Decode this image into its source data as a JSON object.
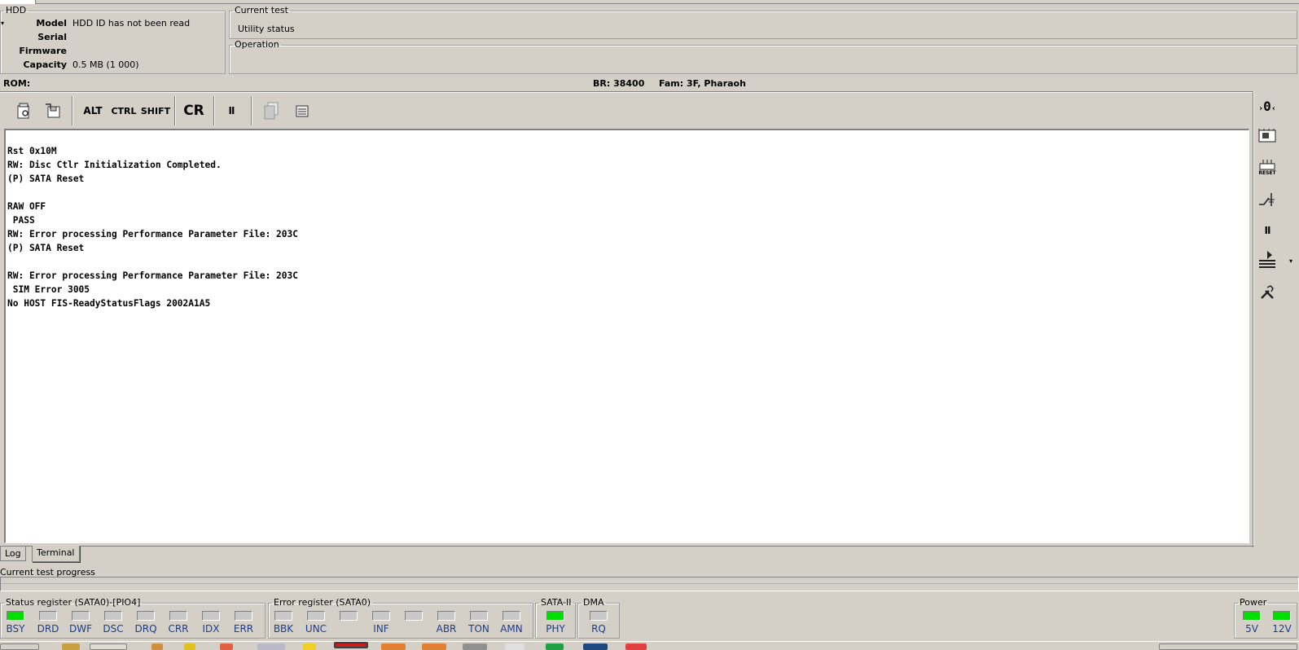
{
  "hdd": {
    "group_label": "HDD",
    "rows": [
      {
        "label": "Model",
        "value": "HDD ID has not been read"
      },
      {
        "label": "Serial",
        "value": ""
      },
      {
        "label": "Firmware",
        "value": ""
      },
      {
        "label": "Capacity",
        "value": "0.5 MB (1 000)"
      }
    ]
  },
  "current_test": {
    "group_label": "Current test",
    "value": "Utility status"
  },
  "operation": {
    "group_label": "Operation",
    "value": ""
  },
  "info_bar": {
    "rom_label": "ROM:",
    "br": "BR: 38400",
    "fam": "Fam: 3F, Pharaoh"
  },
  "toolbar": {
    "alt": "ALT",
    "ctrl": "CTRL",
    "shift": "SHIFT",
    "cr": "CR",
    "pause": "II"
  },
  "terminal": {
    "text": "Rst 0x10M\nRW: Disc Ctlr Initialization Completed.\n(P) SATA Reset\n\nRAW OFF\n PASS\nRW: Error processing Performance Parameter File: 203C\n(P) SATA Reset\n\nRW: Error processing Performance Parameter File: 203C\n SIM Error 3005\nNo HOST FIS-ReadyStatusFlags 2002A1A5"
  },
  "right_toolbar": {
    "power_label": "0",
    "reset_label": "RESET",
    "pause_label": "II"
  },
  "tabs": [
    {
      "label": "Log",
      "active": false
    },
    {
      "label": "Terminal",
      "active": true
    }
  ],
  "progress": {
    "label": "Current test progress",
    "value": 0
  },
  "status_register": {
    "group_label": "Status register (SATA0)-[PIO4]",
    "leds": [
      {
        "name": "BSY",
        "on": true
      },
      {
        "name": "DRD",
        "on": false
      },
      {
        "name": "DWF",
        "on": false
      },
      {
        "name": "DSC",
        "on": false
      },
      {
        "name": "DRQ",
        "on": false
      },
      {
        "name": "CRR",
        "on": false
      },
      {
        "name": "IDX",
        "on": false
      },
      {
        "name": "ERR",
        "on": false
      }
    ]
  },
  "error_register": {
    "group_label": "Error register (SATA0)",
    "leds": [
      {
        "name": "BBK",
        "on": false
      },
      {
        "name": "UNC",
        "on": false
      },
      {
        "name": "",
        "on": false
      },
      {
        "name": "INF",
        "on": false
      },
      {
        "name": "",
        "on": false
      },
      {
        "name": "ABR",
        "on": false
      },
      {
        "name": "TON",
        "on": false
      },
      {
        "name": "AMN",
        "on": false
      }
    ]
  },
  "sata2": {
    "group_label": "SATA-II",
    "leds": [
      {
        "name": "PHY",
        "on": true
      }
    ]
  },
  "dma": {
    "group_label": "DMA",
    "leds": [
      {
        "name": "RQ",
        "on": false
      }
    ]
  },
  "power": {
    "group_label": "Power",
    "leds": [
      {
        "name": "5V",
        "on": true
      },
      {
        "name": "12V",
        "on": true
      }
    ]
  },
  "colors": {
    "window_bg": "#d4d0c8",
    "led_on": "#00e000",
    "led_off": "#c8c8c8",
    "led_label": "#1c3d8c"
  }
}
